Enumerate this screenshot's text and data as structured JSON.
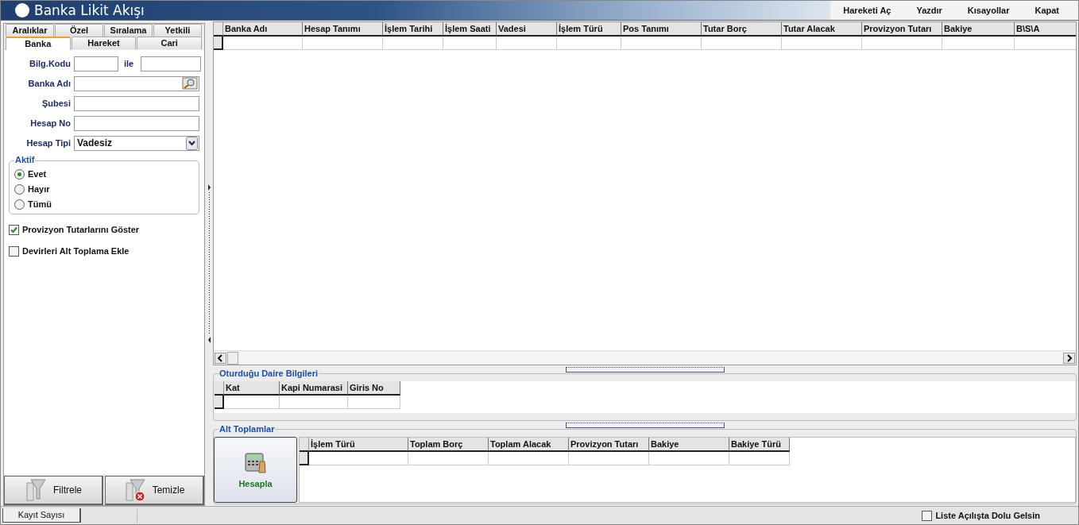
{
  "window": {
    "title": "Banka Likit Akışı"
  },
  "menu": [
    "Hareketi Aç",
    "Yazdır",
    "Kısayollar",
    "Kapat"
  ],
  "tabs_top": [
    {
      "label": "Aralıklar",
      "selected": false
    },
    {
      "label": "Özel",
      "selected": false
    },
    {
      "label": "Sıralama",
      "selected": false
    },
    {
      "label": "Yetkili",
      "selected": false
    }
  ],
  "tabs_bottom": [
    {
      "label": "Banka",
      "selected": true
    },
    {
      "label": "Hareket",
      "selected": false
    },
    {
      "label": "Cari",
      "selected": false
    }
  ],
  "filter": {
    "bilg_kodu_label": "Bilg.Kodu",
    "range_label": "ile",
    "banka_adi_label": "Banka Adı",
    "subesi_label": "Şubesi",
    "hesap_no_label": "Hesap No",
    "hesap_tipi_label": "Hesap Tipi",
    "hesap_tipi_value": "Vadesiz"
  },
  "aktif": {
    "title": "Aktif",
    "options": [
      {
        "label": "Evet",
        "selected": true
      },
      {
        "label": "Hayır",
        "selected": false
      },
      {
        "label": "Tümü",
        "selected": false
      }
    ]
  },
  "checkboxes": [
    {
      "label": "Provizyon Tutarlarını Göster",
      "checked": true
    },
    {
      "label": "Devirleri Alt Toplama Ekle",
      "checked": false
    }
  ],
  "buttons": [
    "Filtrele",
    "Temizle"
  ],
  "main_table": {
    "columns": [
      "Banka Adı",
      "Hesap Tanımı",
      "İşlem Tarihi",
      "İşlem Saati",
      "Vadesi",
      "İşlem Türü",
      "Pos Tanımı",
      "Tutar Borç",
      "Tutar Alacak",
      "Provizyon Tutarı",
      "Bakiye",
      "B\\S\\A"
    ]
  },
  "daire": {
    "title": "Oturduğu Daire Bilgileri",
    "columns": [
      "Kat",
      "Kapi Numarasi",
      "Giris No"
    ]
  },
  "alt_toplamlar": {
    "title": "Alt Toplamlar",
    "button": "Hesapla",
    "columns": [
      "İşlem Türü",
      "Toplam Borç",
      "Toplam Alacak",
      "Provizyon Tutarı",
      "Bakiye",
      "Bakiye Türü"
    ]
  },
  "status_bar": {
    "record_count_label": "Kayıt Sayısı",
    "list_option": {
      "label": "Liste Açılışta Dolu Gelsin",
      "checked": false
    }
  }
}
